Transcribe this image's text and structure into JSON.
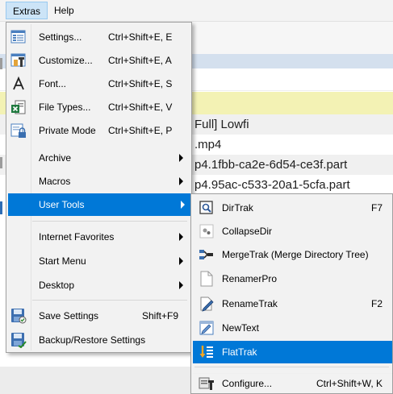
{
  "menubar": {
    "items": [
      {
        "label": "Extras"
      },
      {
        "label": "Help"
      }
    ]
  },
  "background": {
    "rows": [
      "Full] Lowfi",
      ".mp4",
      "p4.1fbb-ca2e-6d54-ce3f.part",
      "p4.95ac-c533-20a1-5cfa.part"
    ]
  },
  "extras_menu": {
    "items": [
      {
        "label": "Settings...",
        "shortcut": "Ctrl+Shift+E, E",
        "icon": "settings-icon"
      },
      {
        "label": "Customize...",
        "shortcut": "Ctrl+Shift+E, A",
        "icon": "customize-icon"
      },
      {
        "label": "Font...",
        "shortcut": "Ctrl+Shift+E, S",
        "icon": "font-icon"
      },
      {
        "label": "File Types...",
        "shortcut": "Ctrl+Shift+E, V",
        "icon": "file-types-icon"
      },
      {
        "label": "Private Mode",
        "shortcut": "Ctrl+Shift+E, P",
        "icon": "private-mode-icon"
      },
      {
        "label": "Archive",
        "submenu": true
      },
      {
        "label": "Macros",
        "submenu": true
      },
      {
        "label": "User Tools",
        "submenu": true,
        "highlighted": true
      },
      {
        "label": "Internet Favorites",
        "submenu": true
      },
      {
        "label": "Start Menu",
        "submenu": true
      },
      {
        "label": "Desktop",
        "submenu": true
      },
      {
        "label": "Save Settings",
        "shortcut": "Shift+F9",
        "icon": "save-settings-icon"
      },
      {
        "label": "Backup/Restore Settings",
        "icon": "backup-restore-icon"
      }
    ]
  },
  "user_tools_menu": {
    "items": [
      {
        "label": "DirTrak",
        "shortcut": "F7",
        "icon": "dirtrak-icon"
      },
      {
        "label": "CollapseDir",
        "icon": "collapsedir-icon"
      },
      {
        "label": "MergeTrak (Merge Directory Tree)",
        "icon": "mergetrak-icon"
      },
      {
        "label": "RenamerPro",
        "icon": "renamerpro-icon"
      },
      {
        "label": "RenameTrak",
        "shortcut": "F2",
        "icon": "renametrak-icon"
      },
      {
        "label": "NewText",
        "icon": "newtext-icon"
      },
      {
        "label": "FlatTrak",
        "icon": "flattrak-icon",
        "highlighted": true
      },
      {
        "label": "Configure...",
        "shortcut": "Ctrl+Shift+W, K",
        "icon": "configure-icon"
      }
    ]
  },
  "colors": {
    "highlight": "#0078d7",
    "menu_background": "#f2f2f2",
    "active_menubar_item": "#cce4f7",
    "yellow_row": "#f3f2b4",
    "path_bar": "#d4e0ee"
  }
}
